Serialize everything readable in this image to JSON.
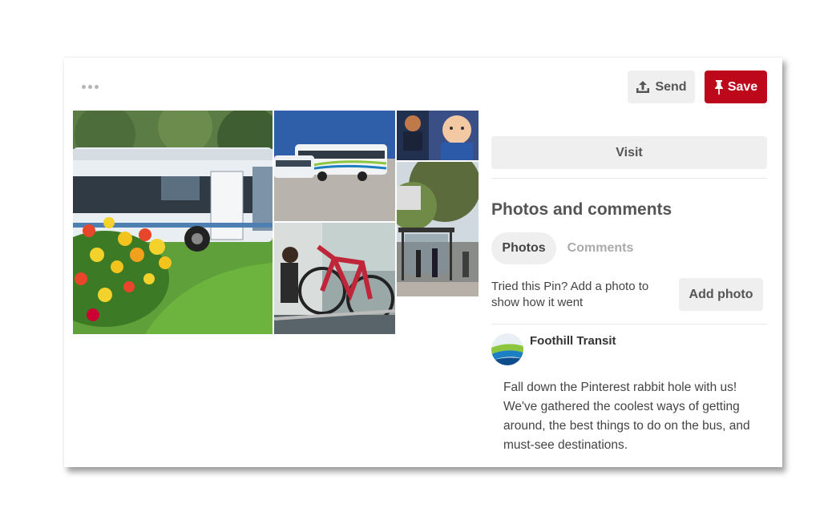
{
  "pin": {
    "actions": {
      "more_label": "More options",
      "send_label": "Send",
      "save_label": "Save"
    },
    "visit_label": "Visit",
    "photos_section": {
      "title": "Photos and comments",
      "tabs": [
        "Photos",
        "Comments"
      ],
      "active_tab": "Photos",
      "prompt": "Tried this Pin? Add a photo to show how it went",
      "add_photo_label": "Add photo"
    },
    "author": {
      "name": "Foothill Transit"
    },
    "description": "Fall down the Pinterest rabbit hole with us! We've gathered the coolest ways of getting around, the best things to do on the bus, and must-see destinations.",
    "colors": {
      "save_red": "#bd081c",
      "button_gray": "#efefef"
    },
    "icons": {
      "send": "share-upload-icon",
      "save": "pushpin-icon",
      "more": "ellipsis-icon"
    }
  }
}
